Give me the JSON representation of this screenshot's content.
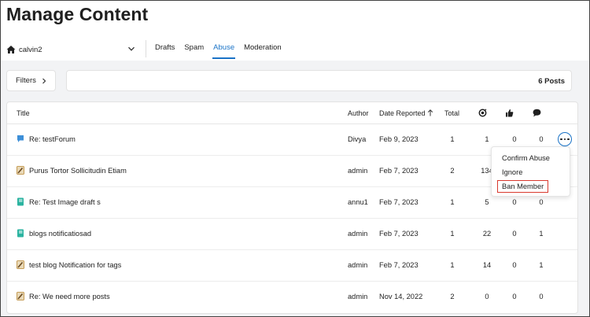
{
  "page": {
    "title": "Manage Content"
  },
  "community": {
    "name": "calvin2"
  },
  "tabs": [
    {
      "label": "Drafts",
      "active": false
    },
    {
      "label": "Spam",
      "active": false
    },
    {
      "label": "Abuse",
      "active": true
    },
    {
      "label": "Moderation",
      "active": false
    }
  ],
  "filters": {
    "label": "Filters"
  },
  "results": {
    "count_label": "6 Posts"
  },
  "table": {
    "headers": {
      "title": "Title",
      "author": "Author",
      "date": "Date Reported",
      "total": "Total",
      "views_icon": "eye-icon",
      "likes_icon": "thumbs-up-icon",
      "comments_icon": "comment-icon"
    },
    "sort": {
      "column": "Date Reported",
      "direction": "ascending"
    },
    "rows": [
      {
        "type": "forum",
        "title": "Re: testForum",
        "author": "Divya",
        "date": "Feb 9, 2023",
        "total": "1",
        "views": "1",
        "likes": "0",
        "comments": "0"
      },
      {
        "type": "idea",
        "title": "Purus Tortor Sollicitudin Etiam",
        "author": "admin",
        "date": "Feb 7, 2023",
        "total": "2",
        "views": "134",
        "likes": "",
        "comments": ""
      },
      {
        "type": "blog",
        "title": "Re: Test Image draft s",
        "author": "annu1",
        "date": "Feb 7, 2023",
        "total": "1",
        "views": "5",
        "likes": "0",
        "comments": "0"
      },
      {
        "type": "blog",
        "title": "blogs notificatiosad",
        "author": "admin",
        "date": "Feb 7, 2023",
        "total": "1",
        "views": "22",
        "likes": "0",
        "comments": "1"
      },
      {
        "type": "idea",
        "title": "test blog Notification for tags",
        "author": "admin",
        "date": "Feb 7, 2023",
        "total": "1",
        "views": "14",
        "likes": "0",
        "comments": "1"
      },
      {
        "type": "idea",
        "title": "Re: We need more posts",
        "author": "admin",
        "date": "Nov 14, 2022",
        "total": "2",
        "views": "0",
        "likes": "0",
        "comments": "0"
      }
    ]
  },
  "row_menu": {
    "items": [
      {
        "label": "Confirm Abuse"
      },
      {
        "label": "Ignore"
      },
      {
        "label": "Ban Member",
        "highlighted": true
      }
    ]
  },
  "colors": {
    "accent": "#1a73c7",
    "highlight_border": "#d9392e",
    "forum_icon": "#3d8fd8",
    "blog_icon": "#2bb3a0",
    "idea_icon": "#b8852f"
  }
}
